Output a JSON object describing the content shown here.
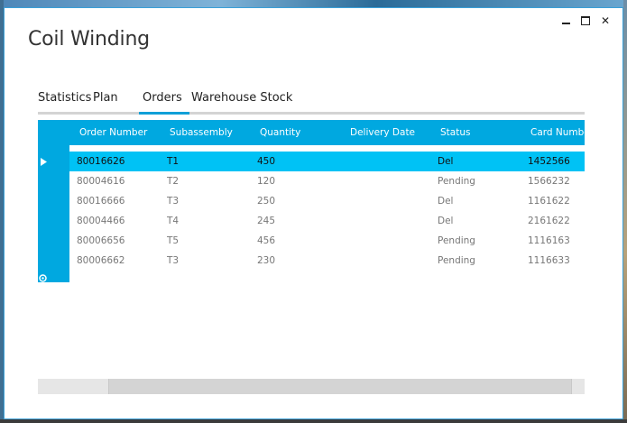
{
  "window": {
    "title": "Coil Winding",
    "controls": {
      "minimize": "",
      "maximize": "",
      "close": "✕"
    }
  },
  "tabs": [
    {
      "label": "Statistics",
      "selected": false
    },
    {
      "label": "Plan",
      "selected": false
    },
    {
      "label": "Orders",
      "selected": true
    },
    {
      "label": "Warehouse Stock",
      "selected": false
    }
  ],
  "grid": {
    "columns": [
      "Order Number",
      "Subassembly",
      "Quantity",
      "Delivery Date",
      "Status",
      "Card Number"
    ],
    "rows": [
      {
        "order": "80016626",
        "sub": "T1",
        "qty": "450",
        "date": "",
        "status": "Del",
        "card": "1452566",
        "selected": true
      },
      {
        "order": "80004616",
        "sub": "T2",
        "qty": "120",
        "date": "",
        "status": "Pending",
        "card": "1566232",
        "selected": false
      },
      {
        "order": "80016666",
        "sub": "T3",
        "qty": "250",
        "date": "",
        "status": "Del",
        "card": "1161622",
        "selected": false
      },
      {
        "order": "80004466",
        "sub": "T4",
        "qty": "245",
        "date": "",
        "status": "Del",
        "card": "2161622",
        "selected": false
      },
      {
        "order": "80006656",
        "sub": "T5",
        "qty": "456",
        "date": "",
        "status": "Pending",
        "card": "1116163",
        "selected": false
      },
      {
        "order": "80006662",
        "sub": "T3",
        "qty": "230",
        "date": "",
        "status": "Pending",
        "card": "1116633",
        "selected": false
      }
    ]
  },
  "colors": {
    "accent": "#00a8e0",
    "selected_row": "#00c2f5",
    "tab_underline": "#10a0d8"
  },
  "icons": {
    "current_row": "triangle-right-icon",
    "new_row": "new-row-icon"
  }
}
